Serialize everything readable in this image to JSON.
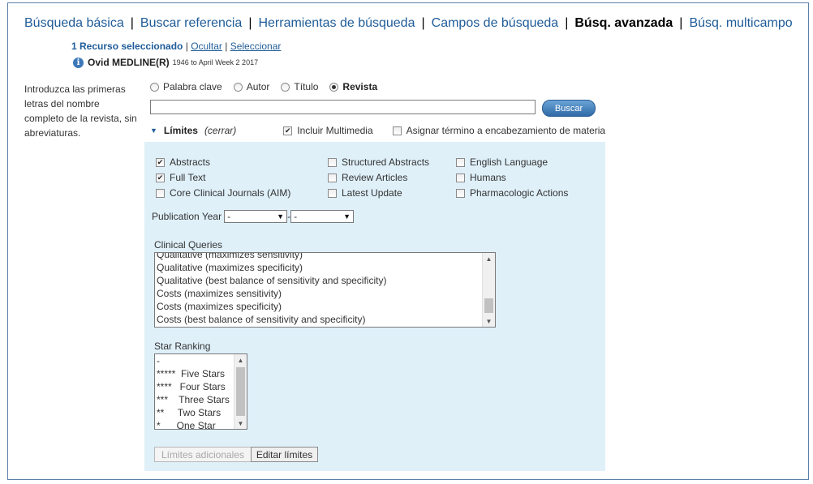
{
  "tabs": [
    "Búsqueda básica",
    "Buscar referencia",
    "Herramientas de búsqueda",
    "Campos de búsqueda",
    "Búsq. avanzada",
    "Búsq. multicampo"
  ],
  "active_tab": "Búsq. avanzada",
  "resources": {
    "selected": "1 Recurso seleccionado",
    "hide": "Ocultar",
    "select": "Seleccionar"
  },
  "database": {
    "icon": "info-icon",
    "name": "Ovid MEDLINE(R)",
    "range": "1946 to April Week 2 2017"
  },
  "instructions": "Introduzca las primeras letras del nombre completo de la revista, sin abreviaturas.",
  "search_modes": [
    {
      "label": "Palabra clave",
      "selected": false
    },
    {
      "label": "Autor",
      "selected": false
    },
    {
      "label": "Título",
      "selected": false
    },
    {
      "label": "Revista",
      "selected": true
    }
  ],
  "search": {
    "value": "",
    "button": "Buscar"
  },
  "limits_header": {
    "title": "Límites",
    "close": "(cerrar)",
    "multimedia": {
      "label": "Incluir Multimedia",
      "checked": true
    },
    "subject_heading": {
      "label": "Asignar término a encabezamiento de materia",
      "checked": false
    }
  },
  "limits": {
    "col1": [
      {
        "label": "Abstracts",
        "checked": true
      },
      {
        "label": "Full Text",
        "checked": true
      },
      {
        "label": "Core Clinical Journals (AIM)",
        "checked": false
      }
    ],
    "col2": [
      {
        "label": "Structured Abstracts",
        "checked": false
      },
      {
        "label": "Review Articles",
        "checked": false
      },
      {
        "label": "Latest Update",
        "checked": false
      }
    ],
    "col3": [
      {
        "label": "English Language",
        "checked": false
      },
      {
        "label": "Humans",
        "checked": false
      },
      {
        "label": "Pharmacologic Actions",
        "checked": false
      }
    ]
  },
  "publication_year": {
    "label": "Publication Year",
    "from": "-",
    "to": "-",
    "separator": "-"
  },
  "clinical_queries": {
    "label": "Clinical Queries",
    "items": [
      "Qualitative (maximizes sensitivity)",
      "Qualitative (maximizes specificity)",
      "Qualitative (best balance of sensitivity and specificity)",
      "Costs (maximizes sensitivity)",
      "Costs (maximizes specificity)",
      "Costs (best balance of sensitivity and specificity)"
    ]
  },
  "star_ranking": {
    "label": "Star Ranking",
    "items": [
      "-",
      "*****  Five Stars",
      "****   Four Stars",
      "***    Three Stars",
      "**     Two Stars",
      "*      One Star"
    ]
  },
  "buttons": {
    "additional": "Límites adicionales",
    "edit": "Editar límites"
  }
}
